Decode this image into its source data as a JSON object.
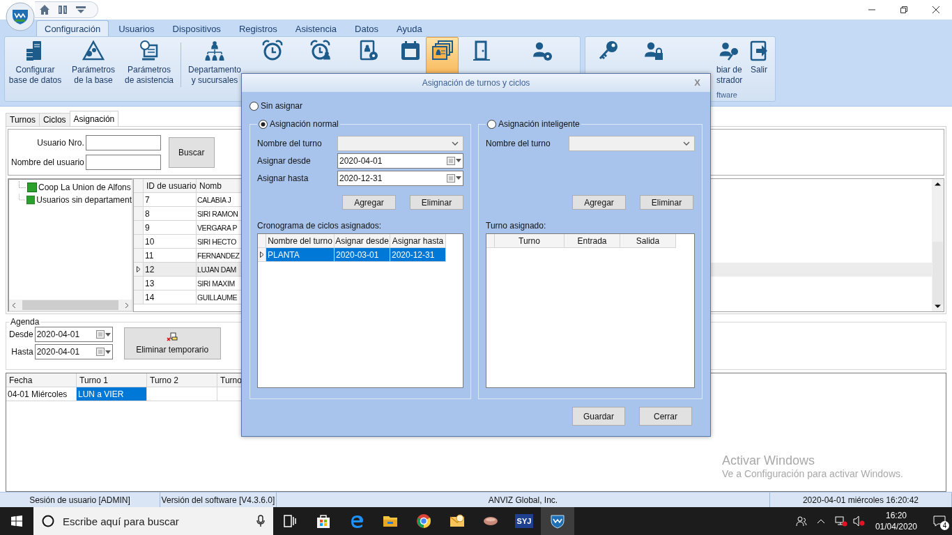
{
  "menu_tabs": [
    {
      "label": "Configuración",
      "selected": true
    },
    {
      "label": "Usuarios",
      "selected": false
    },
    {
      "label": "Dispositivos",
      "selected": false
    },
    {
      "label": "Registros",
      "selected": false
    },
    {
      "label": "Asistencia",
      "selected": false
    },
    {
      "label": "Datos",
      "selected": false
    },
    {
      "label": "Ayuda",
      "selected": false
    }
  ],
  "ribbon": {
    "groups": [
      {
        "sections": [
          [
            {
              "kind": "server",
              "lines": [
                "Configurar",
                "base de datos"
              ],
              "selected": false
            },
            {
              "kind": "gears",
              "lines": [
                "Parámetros",
                "de la base"
              ],
              "selected": false
            },
            {
              "kind": "clock-doc",
              "lines": [
                "Parámetros",
                "de asistencia"
              ],
              "selected": false
            }
          ],
          [
            {
              "kind": "org",
              "lines": [
                "Departamento",
                "y sucursales"
              ],
              "selected": false
            },
            {
              "kind": "alarm",
              "selected": false
            },
            {
              "kind": "alarm-person",
              "selected": false
            },
            {
              "kind": "badge-gear",
              "selected": false
            },
            {
              "kind": "calendar",
              "selected": false
            },
            {
              "kind": "cards",
              "selected": true
            },
            {
              "kind": "door",
              "selected": false
            },
            {
              "kind": "person-gear",
              "selected": false
            }
          ]
        ]
      },
      {
        "label": "ftware",
        "sections": [
          [
            {
              "kind": "key",
              "selected": false
            },
            {
              "kind": "person-lock",
              "selected": false
            },
            {
              "kind": "person-key",
              "lines": [
                "biar de",
                "strador"
              ],
              "selected": false
            },
            {
              "kind": "exit",
              "lines": [
                "Salir"
              ],
              "selected": false
            }
          ]
        ]
      }
    ]
  },
  "sub_tabs": [
    {
      "label": "Turnos",
      "selected": false
    },
    {
      "label": "Ciclos",
      "selected": false
    },
    {
      "label": "Asignación",
      "selected": true
    }
  ],
  "search": {
    "user_no": {
      "label": "Usuario Nro."
    },
    "user_name": {
      "label": "Nombre del usuario"
    },
    "button": "Buscar"
  },
  "tree": [
    {
      "label": "Coop La Union de Alfons"
    },
    {
      "label": "Usuarios sin departament"
    }
  ],
  "users": {
    "columns": [
      "ID de usuario",
      "Nomb"
    ],
    "rows": [
      {
        "id": "7",
        "name": "CALABIA J",
        "selected": false
      },
      {
        "id": "8",
        "name": "SIRI RAMON",
        "selected": false
      },
      {
        "id": "9",
        "name": "VERGARA P",
        "selected": false
      },
      {
        "id": "10",
        "name": "SIRI HECTO",
        "selected": false
      },
      {
        "id": "11",
        "name": "FERNANDEZ",
        "selected": false
      },
      {
        "id": "12",
        "name": "LUJAN DAM",
        "selected": true
      },
      {
        "id": "13",
        "name": "SIRI MAXIM",
        "selected": false
      },
      {
        "id": "14",
        "name": "GUILLAUME",
        "selected": false
      }
    ]
  },
  "agenda": {
    "title": "Agenda",
    "from": {
      "label": "Desde",
      "value": "2020-04-01"
    },
    "to": {
      "label": "Hasta",
      "value": "2020-04-01"
    },
    "delete_button": "Eliminar temporario"
  },
  "schedule": {
    "columns": [
      "Fecha",
      "Turno 1",
      "Turno 2",
      "Turno"
    ],
    "rows": [
      {
        "cells": [
          {
            "text": "04-01 Miércoles",
            "selected": false
          },
          {
            "text": "LUN a VIER",
            "selected": true
          }
        ]
      }
    ]
  },
  "dialog": {
    "title": "Asignación de turnos y ciclos",
    "close": "X",
    "none_option": {
      "label": "Sin asignar",
      "selected": false
    },
    "normal": {
      "label": "Asignación normal",
      "selected": true,
      "shift_label": "Nombre del turno",
      "from_label": "Asignar desde",
      "from_value": "2020-04-01",
      "to_label": "Asignar hasta",
      "to_value": "2020-12-31",
      "add": "Agregar",
      "remove": "Eliminar",
      "list_label": "Cronograma de ciclos asignados:",
      "columns": [
        "Nombre del turno",
        "Asignar desde",
        "Asignar hasta"
      ],
      "rows": [
        {
          "cells": [
            "PLANTA",
            "2020-03-01",
            "2020-12-31"
          ],
          "selected": true
        }
      ]
    },
    "smart": {
      "label": "Asignación inteligente",
      "selected": false,
      "shift_label": "Nombre del turno",
      "add": "Agregar",
      "remove": "Eliminar",
      "list_label": "Turno asignado:",
      "columns": [
        "Turno",
        "Entrada",
        "Salida"
      ]
    },
    "save": "Guardar",
    "cancel": "Cerrar"
  },
  "activation_notice": {
    "title": "Activar Windows",
    "text": "Ve a Configuración para activar Windows."
  },
  "status_bar": [
    "Sesión de usuario  [ADMIN]",
    "Versión del software  [V4.3.6.0]",
    "ANVIZ Global, Inc.",
    "2020-04-01 miércoles 16:20:42"
  ],
  "taskbar": {
    "search": {
      "placeholder": "Escribe aquí para buscar"
    },
    "apps": [
      {
        "kind": "taskview",
        "active": false
      },
      {
        "kind": "store",
        "active": false
      },
      {
        "kind": "edge",
        "active": false
      },
      {
        "kind": "explorer",
        "active": false
      },
      {
        "kind": "chrome",
        "active": false
      },
      {
        "kind": "mail",
        "active": false
      },
      {
        "kind": "pill",
        "active": false
      },
      {
        "kind": "text",
        "label": "SYJ",
        "active": false
      },
      {
        "kind": "shield",
        "active": true
      }
    ],
    "time": "16:20",
    "date": "01/04/2020",
    "notifications": "4"
  }
}
